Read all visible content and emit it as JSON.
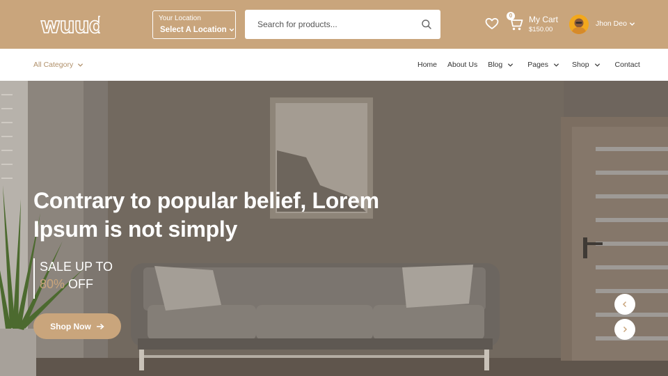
{
  "header": {
    "logo_text": "wuud",
    "location": {
      "label": "Your Location",
      "value": "Select A Location"
    },
    "search": {
      "placeholder": "Search for products..."
    },
    "cart": {
      "badge": "0",
      "title": "My Cart",
      "total": "$150.00"
    },
    "user": {
      "name": "Jhon Deo"
    }
  },
  "nav": {
    "all_category": "All Category",
    "items": [
      {
        "label": "Home"
      },
      {
        "label": "About Us"
      },
      {
        "label": "Blog"
      },
      {
        "label": "Pages"
      },
      {
        "label": "Shop"
      },
      {
        "label": "Contact"
      }
    ]
  },
  "hero": {
    "headline_line1": "Contrary to popular belief, Lorem",
    "headline_line2": "Ipsum is not simply",
    "promo_line1": "SALE UP TO",
    "promo_percent": "80%",
    "promo_suffix": "OFF",
    "cta_label": "Shop Now"
  },
  "colors": {
    "brand": "#c9a57c",
    "header_text": "#ffffff",
    "nav_text": "#333333",
    "hero_overlay": "#6f665e"
  },
  "icons": {
    "search": "search-icon",
    "wishlist": "heart-icon",
    "cart": "cart-icon",
    "dropdown": "chevron-down-icon",
    "cta": "arrow-right-icon",
    "prev": "chevron-left-icon",
    "next": "chevron-right-icon"
  }
}
